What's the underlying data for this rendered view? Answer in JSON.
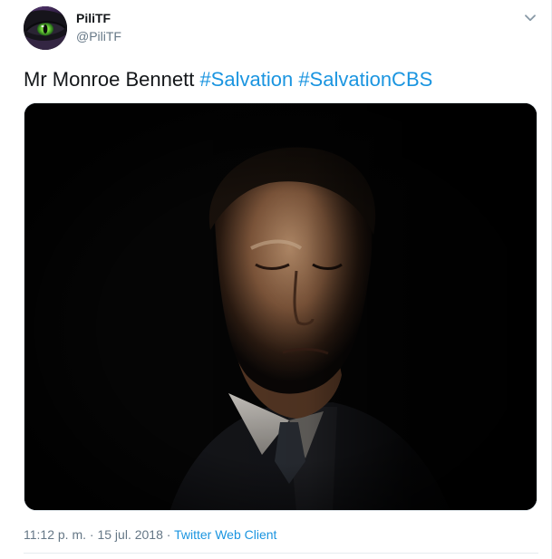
{
  "author": {
    "display_name": "PiliTF",
    "handle": "@PiliTF",
    "avatar_icon": "eye-avatar-icon"
  },
  "menu": {
    "icon": "chevron-down-icon"
  },
  "tweet": {
    "text_prefix": "Mr Monroe Bennett ",
    "hashtags": [
      "#Salvation",
      "#SalvationCBS"
    ]
  },
  "media": {
    "icon": "photo-man-in-suit"
  },
  "meta": {
    "time": "11:12 p. m.",
    "separator_1": " · ",
    "date": "15 jul. 2018",
    "separator_2": " · ",
    "client": "Twitter Web Client"
  },
  "colors": {
    "link": "#1b95e0",
    "secondary_text": "#657786",
    "primary_text": "#14171a",
    "divider": "#e6ecf0"
  }
}
